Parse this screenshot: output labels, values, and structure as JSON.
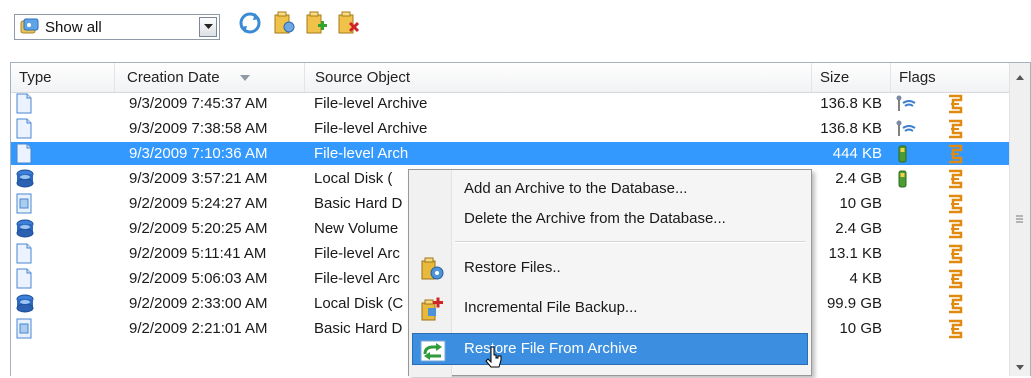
{
  "toolbar": {
    "filter": {
      "selected": "Show all",
      "icon": "archive-filter-icon"
    },
    "buttons": [
      {
        "name": "refresh-button",
        "icon": "refresh-icon"
      },
      {
        "name": "archive-properties-button",
        "icon": "archive-properties-icon"
      },
      {
        "name": "add-archive-button",
        "icon": "add-archive-icon"
      },
      {
        "name": "delete-archive-button",
        "icon": "delete-archive-icon"
      }
    ]
  },
  "list": {
    "columns": {
      "type": "Type",
      "creation_date": "Creation Date",
      "source_object": "Source Object",
      "size": "Size",
      "flags": "Flags"
    },
    "rows": [
      {
        "type_icon": "file-icon",
        "date": "9/3/2009 7:45:37 AM",
        "source": "File-level Archive",
        "size": "136.8 KB",
        "flag1": "network-icon",
        "flag2": "archive-flag-icon",
        "selected": false
      },
      {
        "type_icon": "file-icon",
        "date": "9/3/2009 7:38:58 AM",
        "source": "File-level Archive",
        "size": "136.8 KB",
        "flag1": "network-icon",
        "flag2": "archive-flag-icon",
        "selected": false
      },
      {
        "type_icon": "file-icon",
        "date": "9/3/2009 7:10:36 AM",
        "source": "File-level Arch",
        "size": "444 KB",
        "flag1": "usb-icon",
        "flag2": "archive-flag-icon",
        "selected": true
      },
      {
        "type_icon": "disk-icon",
        "date": "9/3/2009 3:57:21 AM",
        "source": "Local Disk (",
        "size": "2.4 GB",
        "flag1": "usb-icon",
        "flag2": "archive-flag-icon",
        "selected": false
      },
      {
        "type_icon": "hard-disk-icon",
        "date": "9/2/2009 5:24:27 AM",
        "source": "Basic Hard D",
        "size": "10 GB",
        "flag1": "",
        "flag2": "archive-flag-icon",
        "selected": false
      },
      {
        "type_icon": "disk-icon",
        "date": "9/2/2009 5:20:25 AM",
        "source": "New Volume",
        "size": "2.4 GB",
        "flag1": "",
        "flag2": "archive-flag-icon",
        "selected": false
      },
      {
        "type_icon": "file-icon",
        "date": "9/2/2009 5:11:41 AM",
        "source": "File-level Arc",
        "size": "13.1 KB",
        "flag1": "",
        "flag2": "archive-flag-icon",
        "selected": false
      },
      {
        "type_icon": "file-icon",
        "date": "9/2/2009 5:06:03 AM",
        "source": "File-level Arc",
        "size": "4 KB",
        "flag1": "",
        "flag2": "archive-flag-icon",
        "selected": false
      },
      {
        "type_icon": "disk-icon",
        "date": "9/2/2009 2:33:00 AM",
        "source": "Local Disk (C",
        "size": "99.9 GB",
        "flag1": "",
        "flag2": "archive-flag-icon",
        "selected": false
      },
      {
        "type_icon": "hard-disk-icon",
        "date": "9/2/2009 2:21:01 AM",
        "source": "Basic Hard D",
        "size": "10 GB",
        "flag1": "",
        "flag2": "archive-flag-icon",
        "selected": false
      }
    ]
  },
  "context_menu": {
    "items": [
      {
        "label": "Add an Archive to the Database...",
        "icon": "",
        "hover": false
      },
      {
        "label": "Delete the Archive from the Database...",
        "icon": "",
        "hover": false
      },
      {
        "label": "Restore Files..",
        "icon": "restore-files-icon",
        "hover": false
      },
      {
        "label": "Incremental File Backup...",
        "icon": "incremental-backup-icon",
        "hover": false
      },
      {
        "label": "Restore File From Archive",
        "icon": "restore-from-archive-icon",
        "hover": true
      }
    ]
  },
  "colors": {
    "selection": "#3399ff",
    "menu_hover": "#3c8fe0"
  }
}
